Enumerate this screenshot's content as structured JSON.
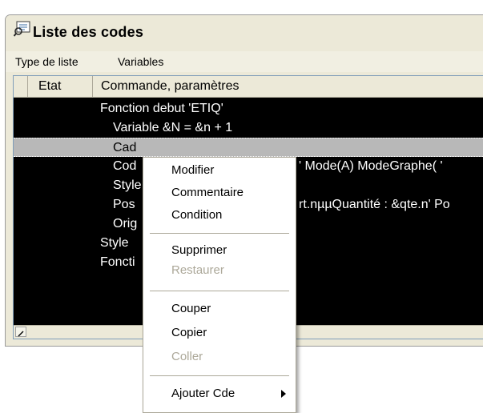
{
  "window": {
    "title": "Liste des codes",
    "icon": "code-list-icon"
  },
  "menubar": {
    "items": [
      "Type de liste",
      "Variables"
    ]
  },
  "list": {
    "columns": [
      "Etat",
      "Commande, paramètres"
    ],
    "rows": [
      {
        "text": "Fonction debut 'ETIQ'",
        "selected": false
      },
      {
        "text": "Variable &N = &n + 1",
        "selected": false
      },
      {
        "text": "Cad",
        "selected": true
      },
      {
        "text": "Cod",
        "extra": "' Mode(A) ModeGraphe( '",
        "selected": false
      },
      {
        "text": "Style",
        "selected": false
      },
      {
        "text": "Pos",
        "extra": "rt.nµµQuantité : &qte.n' Po",
        "selected": false
      },
      {
        "text": "Orig",
        "selected": false
      },
      {
        "text": "Style",
        "selected": false
      },
      {
        "text": "Foncti",
        "selected": false
      }
    ]
  },
  "context_menu": {
    "groups": [
      [
        {
          "label": "Modifier",
          "enabled": true
        },
        {
          "label": "Commentaire",
          "enabled": true
        },
        {
          "label": "Condition",
          "enabled": true
        }
      ],
      [
        {
          "label": "Supprimer",
          "enabled": true
        },
        {
          "label": "Restaurer",
          "enabled": false
        }
      ],
      [
        {
          "label": "Couper",
          "enabled": true
        },
        {
          "label": "Copier",
          "enabled": true
        },
        {
          "label": "Coller",
          "enabled": false
        }
      ],
      [
        {
          "label": "Ajouter Cde",
          "enabled": true,
          "submenu": true
        }
      ]
    ]
  }
}
